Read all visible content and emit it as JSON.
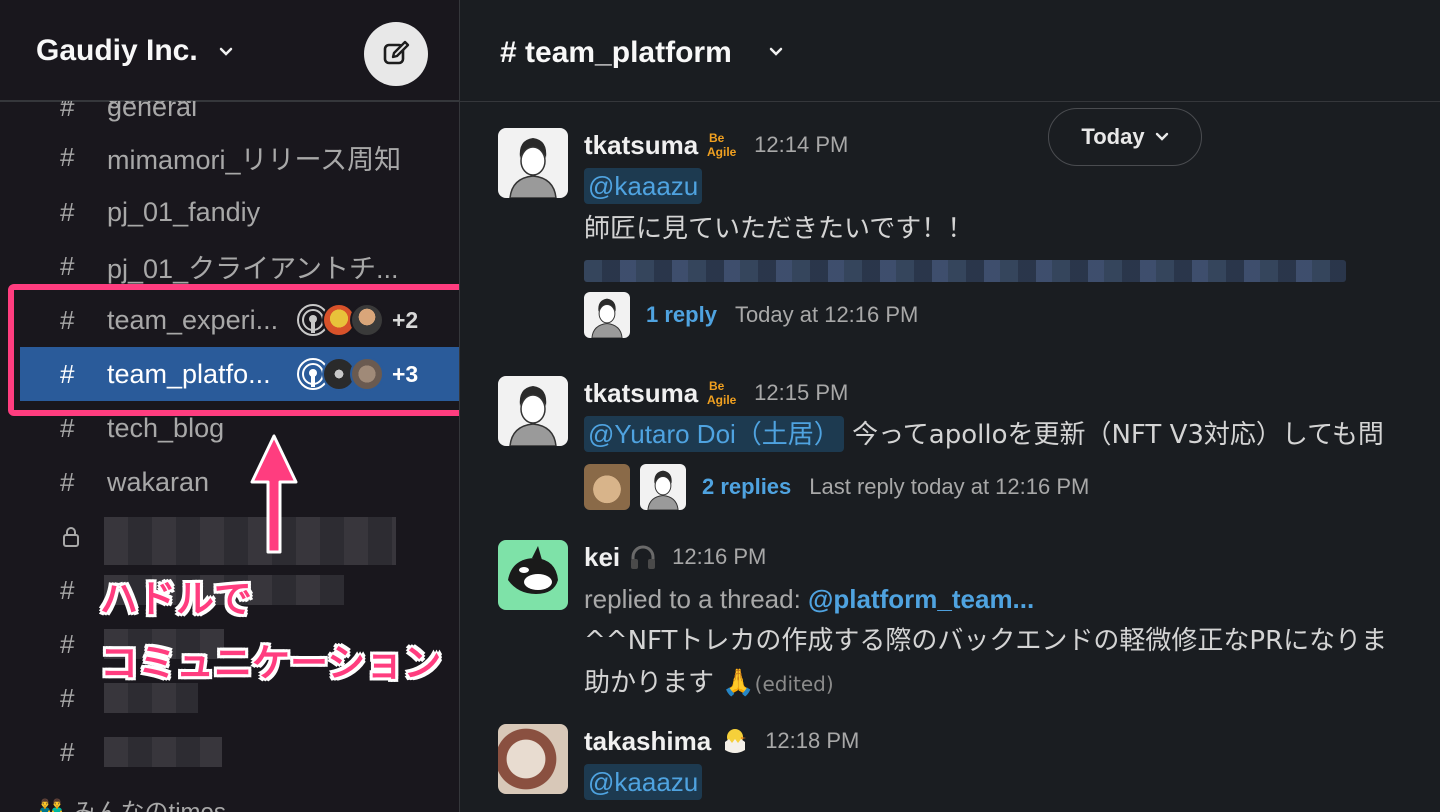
{
  "sidebar": {
    "workspace_name": "Gaudiy Inc.",
    "channels": [
      {
        "label": "general"
      },
      {
        "label": "mimamori_リリース周知"
      },
      {
        "label": "pj_01_fandiy"
      },
      {
        "label": "pj_01_クライアントチ..."
      },
      {
        "label": "team_experi...",
        "huddle_count": "+2"
      },
      {
        "label": "team_platfo...",
        "huddle_count": "+3"
      },
      {
        "label": "tech_blog"
      },
      {
        "label": "wakaran"
      }
    ],
    "bottom_section": "みんなのtimes"
  },
  "annotation": {
    "line1": "ハドルで",
    "line2": "コミュニケーション",
    "color": "#ff3d7f"
  },
  "header": {
    "channel_title": "# team_platform"
  },
  "date_divider": "Today",
  "messages": [
    {
      "author": "tkatsuma",
      "time": "12:14 PM",
      "mention": "@kaaazu",
      "text": "師匠に見ていただきたいです！！",
      "reply_count": "1 reply",
      "reply_meta": "Today at 12:16 PM"
    },
    {
      "author": "tkatsuma",
      "time": "12:15 PM",
      "mention": "@Yutaro Doi（土居）",
      "text": " 今ってapolloを更新（NFT V3対応）しても問",
      "reply_count": "2 replies",
      "reply_meta": "Last reply today at 12:16 PM"
    },
    {
      "author": "kei",
      "time": "12:16 PM",
      "thread_prefix": "replied to a thread: ",
      "thread_link": "@platform_team...",
      "line1": "^^NFTトレカの作成する際のバックエンドの軽微修正なPRになりま",
      "line2": "助かります",
      "edited": "(edited)"
    },
    {
      "author": "takashima",
      "time": "12:18 PM",
      "mention": "@kaaazu"
    }
  ],
  "colors": {
    "active_channel": "#2a5b9a",
    "mention_text": "#4fa3e0",
    "sidebar_bg": "#19171d",
    "main_bg": "#1a1d21"
  }
}
